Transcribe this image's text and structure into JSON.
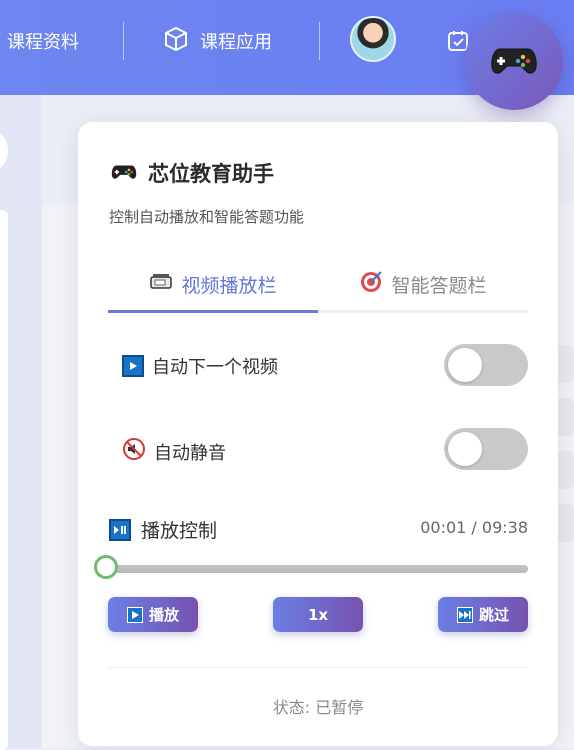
{
  "nav": {
    "items": [
      {
        "label": "课程资料",
        "icon": "document-icon"
      },
      {
        "label": "课程应用",
        "icon": "cube-icon"
      }
    ],
    "avatar": "user-avatar",
    "next_icon": "calendar-check-icon"
  },
  "fab": {
    "icon": "gamepad-icon"
  },
  "panel": {
    "title": "芯位教育助手",
    "subtitle": "控制自动播放和智能答题功能",
    "tabs": [
      {
        "label": "视频播放栏",
        "icon": "video-projector-icon",
        "active": true
      },
      {
        "label": "智能答题栏",
        "icon": "target-icon",
        "active": false
      }
    ],
    "settings": [
      {
        "label": "自动下一个视频",
        "icon": "play-icon",
        "enabled": false
      },
      {
        "label": "自动静音",
        "icon": "mute-icon",
        "enabled": false
      }
    ],
    "playback": {
      "label": "播放控制",
      "icon": "play-pause-icon",
      "time": "00:01 / 09:38",
      "progress": 0.002
    },
    "buttons": {
      "play": "播放",
      "speed": "1x",
      "skip": "跳过"
    },
    "status": "状态: 已暂停"
  },
  "colors": {
    "accent": "#6a7ad8",
    "header": "#6e86f0",
    "button_start": "#6b7fe6",
    "button_end": "#7652ae",
    "toggle_off": "#c9c9c9",
    "slider_thumb": "#6dbb6d"
  }
}
